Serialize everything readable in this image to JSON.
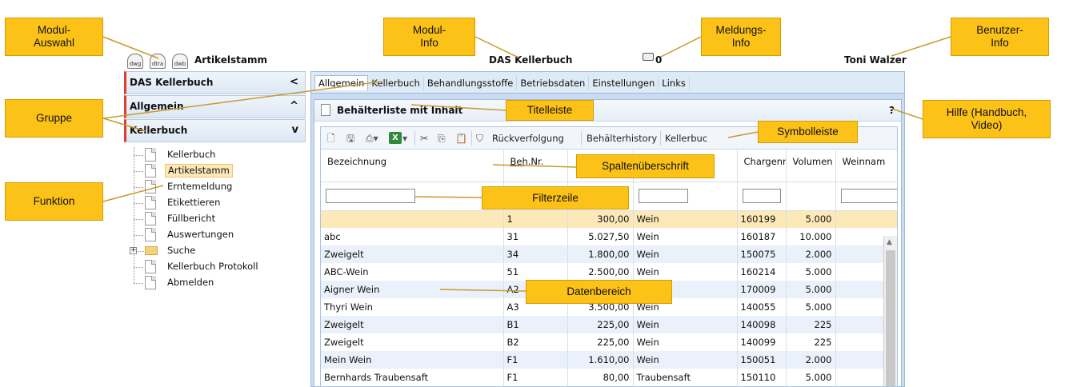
{
  "header": {
    "module_icons": [
      "dwg",
      "dtra",
      "dwb"
    ],
    "module_title": "Artikelstamm",
    "module_info": "DAS Kellerbuch",
    "message_count": "0",
    "user": "Toni Walzer"
  },
  "sidebar": {
    "groups": [
      {
        "label": "DAS Kellerbuch",
        "chevron": "<"
      },
      {
        "label": "Allgemein",
        "chevron": "^"
      },
      {
        "label": "Kellerbuch",
        "chevron": "v"
      }
    ],
    "items": [
      {
        "label": "Kellerbuch"
      },
      {
        "label": "Artikelstamm",
        "selected": true
      },
      {
        "label": "Erntemeldung"
      },
      {
        "label": "Etikettieren"
      },
      {
        "label": "Füllbericht"
      },
      {
        "label": "Auswertungen"
      },
      {
        "label": "Suche",
        "folder": true
      },
      {
        "label": "Kellerbuch Protokoll"
      },
      {
        "label": "Abmelden"
      }
    ]
  },
  "tabs": [
    "Allgemein",
    "Kellerbuch",
    "Behandlungsstoffe",
    "Betriebsdaten",
    "Einstellungen",
    "Links"
  ],
  "panel": {
    "title": "Behälterliste mit Inhalt",
    "help": "?"
  },
  "toolbar": {
    "icons": [
      "new-document-icon",
      "save-icon",
      "print-icon",
      "excel-icon",
      "cut-icon",
      "copy-icon",
      "paste-icon",
      "filter-icon"
    ],
    "links": [
      "Rückverfolgung",
      "Behälterhistory",
      "Kellerbuc"
    ]
  },
  "table": {
    "columns": [
      "Bezeichnung",
      "Beh.Nr.",
      "",
      "",
      "Chargenr",
      "Volumen",
      "Weinnam"
    ],
    "rows": [
      [
        "",
        "1",
        "300,00",
        "Wein",
        "160199",
        "5.000",
        ""
      ],
      [
        "abc",
        "31",
        "5.027,50",
        "Wein",
        "160187",
        "10.000",
        ""
      ],
      [
        "Zweigelt",
        "34",
        "1.800,00",
        "Wein",
        "150075",
        "2.000",
        ""
      ],
      [
        "ABC-Wein",
        "51",
        "2.500,00",
        "Wein",
        "160214",
        "5.000",
        ""
      ],
      [
        "Aigner Wein",
        "A2",
        "",
        "",
        "170009",
        "5.000",
        ""
      ],
      [
        "Thyri Wein",
        "A3",
        "3.500,00",
        "Wein",
        "140055",
        "5.000",
        ""
      ],
      [
        "Zweigelt",
        "B1",
        "225,00",
        "Wein",
        "140098",
        "225",
        ""
      ],
      [
        "Zweigelt",
        "B2",
        "225,00",
        "Wein",
        "140099",
        "225",
        ""
      ],
      [
        "Mein Wein",
        "F1",
        "1.610,00",
        "Wein",
        "150051",
        "2.000",
        ""
      ],
      [
        "Bernhards Traubensaft",
        "F1",
        "80,00",
        "Traubensaft",
        "150110",
        "5.000",
        ""
      ]
    ]
  },
  "callouts": {
    "modul_auswahl": "Modul-\nAuswahl",
    "modul_info": "Modul-\nInfo",
    "meldungs_info": "Meldungs-\nInfo",
    "benutzer_info": "Benutzer-\nInfo",
    "gruppe": "Gruppe",
    "titelleiste": "Titelleiste",
    "hilfe": "Hilfe (Handbuch,\nVideo)",
    "symbolleiste": "Symbolleiste",
    "funktion": "Funktion",
    "spaltenueberschrift": "Spaltenüberschrift",
    "filterzeile": "Filterzeile",
    "datenbereich": "Datenbereich"
  },
  "colors": {
    "callout": "#fcc218",
    "selection": "#fde8b8",
    "group_accent": "#d8402f",
    "frame": "#c9dcf1"
  }
}
